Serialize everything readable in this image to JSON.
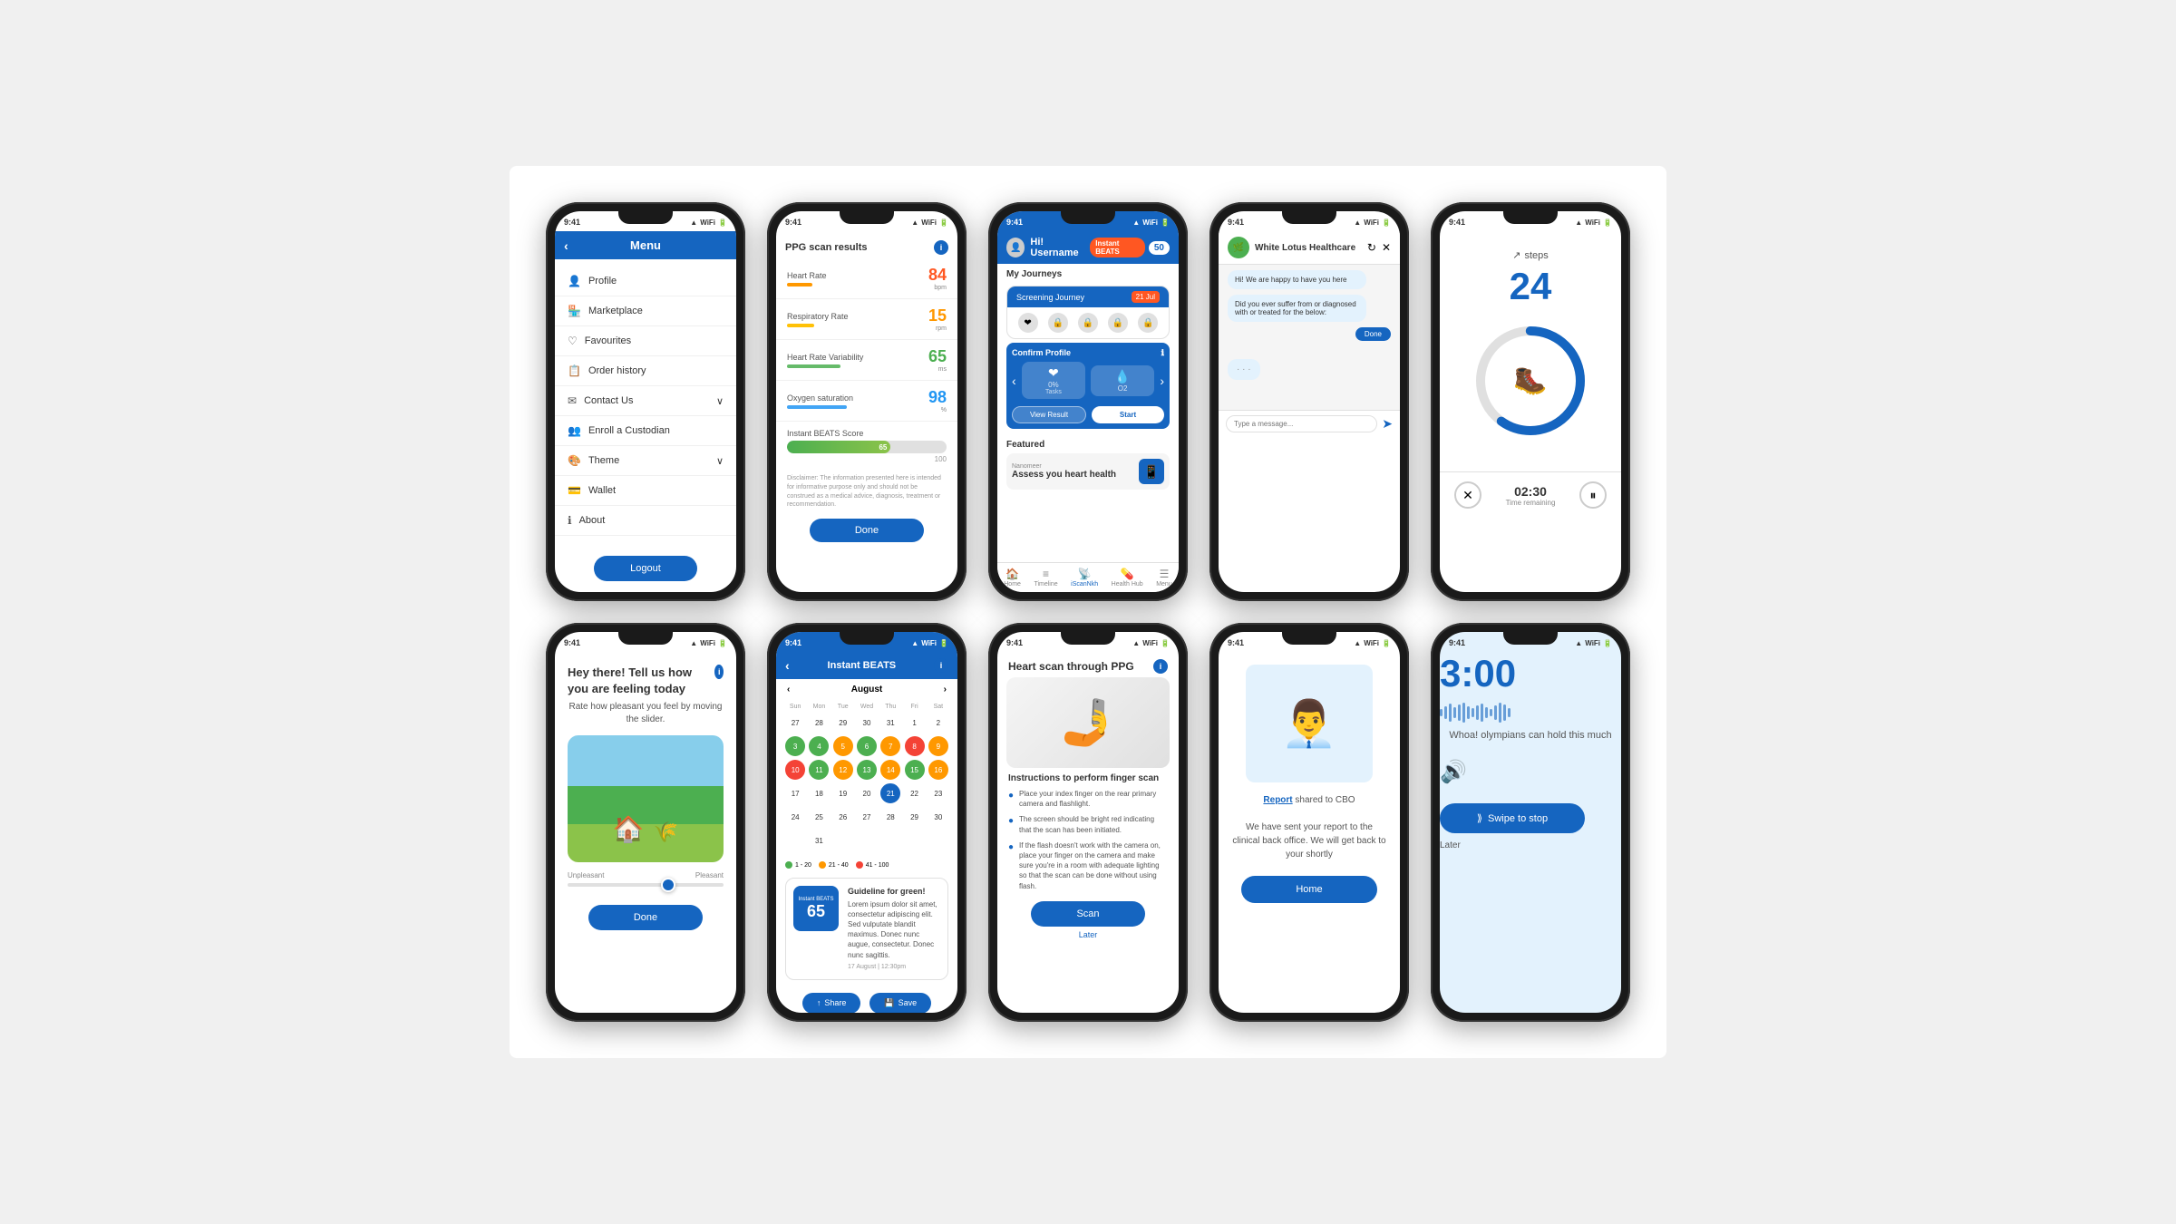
{
  "phones": {
    "phone1": {
      "status_time": "9:41",
      "header": "Menu",
      "menu_items": [
        {
          "icon": "👤",
          "label": "Profile",
          "arrow": false
        },
        {
          "icon": "🏪",
          "label": "Marketplace",
          "arrow": false
        },
        {
          "icon": "♡",
          "label": "Favourites",
          "arrow": false
        },
        {
          "icon": "📋",
          "label": "Order history",
          "arrow": false
        },
        {
          "icon": "✉",
          "label": "Contact Us",
          "arrow": true
        },
        {
          "icon": "👥",
          "label": "Enroll a Custodian",
          "arrow": false
        },
        {
          "icon": "🎨",
          "label": "Theme",
          "arrow": true
        },
        {
          "icon": "💳",
          "label": "Wallet",
          "arrow": false
        },
        {
          "icon": "ℹ",
          "label": "About",
          "arrow": false
        }
      ],
      "logout_label": "Logout"
    },
    "phone2": {
      "status_time": "9:41",
      "title": "PPG scan results",
      "metrics": [
        {
          "name": "Heart Rate",
          "value": "84",
          "unit": "bpm",
          "color": "#FF5722",
          "bar_color": "#FF9800",
          "bar_width": "65%"
        },
        {
          "name": "Respiratory Rate",
          "value": "15",
          "unit": "rpm",
          "color": "#FF9800",
          "bar_color": "#FFC107",
          "bar_width": "45%"
        },
        {
          "name": "Heart Rate Variability",
          "value": "65",
          "unit": "ms",
          "color": "#4CAF50",
          "bar_color": "#66BB6A",
          "bar_width": "70%"
        },
        {
          "name": "Oxygen saturation",
          "value": "98",
          "unit": "%",
          "color": "#2196F3",
          "bar_color": "#42A5F5",
          "bar_width": "90%"
        }
      ],
      "score_label": "Instant BEATS Score",
      "score_value": "65",
      "score_max": "100",
      "disclaimer": "Disclaimer: The information presented here is intended for informative purpose only and should not be construed as a medical advice, diagnosis, treatment or recommendation.",
      "done_label": "Done"
    },
    "phone3": {
      "status_time": "9:41",
      "username": "Hi! Username",
      "instant_beats_label": "Instant BEATS",
      "beats_value": "50",
      "section_journeys": "My Journeys",
      "journey_name": "Screening Journey",
      "journey_date": "21 Jul",
      "confirm_profile": "Confirm Profile",
      "task_0": "0%",
      "task_label": "Tasks",
      "o2_label": "O2",
      "view_result": "View Result",
      "start": "Start",
      "featured": "Featured",
      "nanomeer": "Nanomeer",
      "featured_title": "Assess you heart health",
      "nav_items": [
        "Home",
        "Timeline",
        "iScanNkh",
        "Health Hub",
        "Menu"
      ],
      "active_nav": "iScanNkh"
    },
    "phone4": {
      "status_time": "9:41",
      "chat_name": "White Lotus Healthcare",
      "bot_message": "Hi! We are happy to have you here",
      "question": "Did you ever suffer from or diagnosed with or treated for the below:",
      "done_chip": "Done",
      "typing": "···"
    },
    "phone5": {
      "status_time": "9:41",
      "steps_label": "steps",
      "steps_value": "24",
      "timer_value": "02:30",
      "timer_label": "Time remaining",
      "progress": 60
    },
    "phone6": {
      "status_time": "9:41",
      "title": "Hey there! Tell us how you are feeling today",
      "subtitle": "Rate how pleasant you feel by moving the slider.",
      "slider_min": "Unpleasant",
      "slider_max": "Pleasant",
      "done_label": "Done"
    },
    "phone7": {
      "status_time": "9:41",
      "header": "Instant BEATS",
      "month": "August",
      "days": [
        "Sun",
        "Mon",
        "Tue",
        "Wed",
        "Thu",
        "Fri",
        "Sat"
      ],
      "weeks": [
        [
          27,
          28,
          29,
          30,
          31,
          1,
          2
        ],
        [
          3,
          4,
          5,
          6,
          7,
          8,
          9
        ],
        [
          10,
          11,
          12,
          13,
          14,
          15,
          16
        ],
        [
          17,
          18,
          19,
          20,
          21,
          22,
          23
        ],
        [
          24,
          25,
          26,
          27,
          28,
          29,
          30
        ],
        [
          "",
          31
        ]
      ],
      "colored": {
        "3": "green",
        "4": "green",
        "5": "orange",
        "6": "green",
        "7": "orange",
        "8": "red",
        "9": "orange",
        "10": "red",
        "11": "green",
        "12": "orange",
        "13": "green",
        "14": "orange",
        "15": "green",
        "16": "orange",
        "21": "active"
      },
      "legend": [
        {
          "color": "#4CAF50",
          "label": "1 - 20"
        },
        {
          "color": "#FF9800",
          "label": "21 - 40"
        },
        {
          "color": "#F44336",
          "label": "41 - 100"
        }
      ],
      "score_label": "Instant BEATS",
      "score_value": "65",
      "guideline_title": "Guideline for green!",
      "guideline_text": "Lorem ipsum dolor sit amet, consectetur adipiscing elit. Sed vulputate blandit maximus. Donec nunc augue, consectetur. Donec nunc sagittis.",
      "score_date": "17 August | 12:30pm",
      "share_label": "Share",
      "save_label": "Save",
      "dots": [
        true,
        false,
        false
      ]
    },
    "phone8": {
      "status_time": "9:41",
      "title": "Heart scan through PPG",
      "instructions_title": "Instructions to perform finger scan",
      "instructions": [
        "Place your index finger on the rear primary camera and flashlight.",
        "The screen should be bright red indicating that the scan has been initiated.",
        "If the flash doesn't work with the camera on, place your finger on the camera and make sure you're in a room with adequate lighting so that the scan can be done without using flash."
      ],
      "scan_label": "Scan",
      "later_label": "Later"
    },
    "phone9": {
      "status_time": "9:41",
      "report_link": "Report",
      "report_text1": "shared to CBO",
      "report_text2": "We have sent your report to the clinical back office. We will get back to your shortly",
      "home_label": "Home"
    },
    "phone10": {
      "status_time": "9:41",
      "timer_value": "3:00",
      "message": "Whoa! olympians can hold this much",
      "swipe_label": "Swipe to stop",
      "later_label": "Later",
      "wave_heights": [
        8,
        12,
        16,
        20,
        14,
        10,
        18,
        22,
        16,
        12,
        8,
        14,
        20,
        16,
        10,
        12,
        18,
        14,
        8,
        16
      ]
    }
  }
}
